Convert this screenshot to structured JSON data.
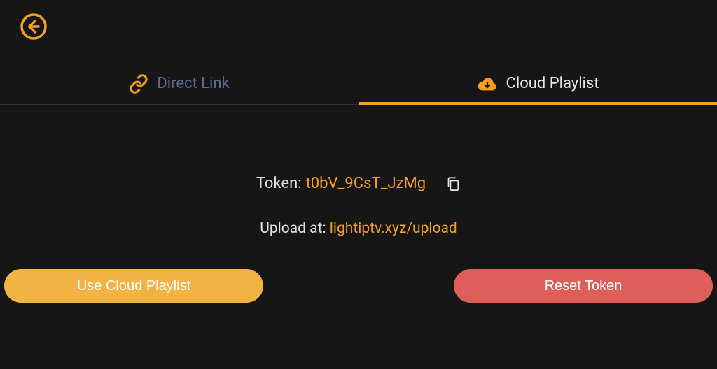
{
  "tabs": {
    "direct_link": {
      "label": "Direct Link"
    },
    "cloud_playlist": {
      "label": "Cloud Playlist"
    }
  },
  "token": {
    "label": "Token: ",
    "value": "t0bV_9CsT_JzMg"
  },
  "upload": {
    "label": "Upload at: ",
    "url": "lightiptv.xyz/upload"
  },
  "buttons": {
    "use_cloud": "Use Cloud Playlist",
    "reset_token": "Reset Token"
  },
  "colors": {
    "accent": "#f6a01d",
    "danger": "#de5e5a",
    "bg": "#161616"
  }
}
